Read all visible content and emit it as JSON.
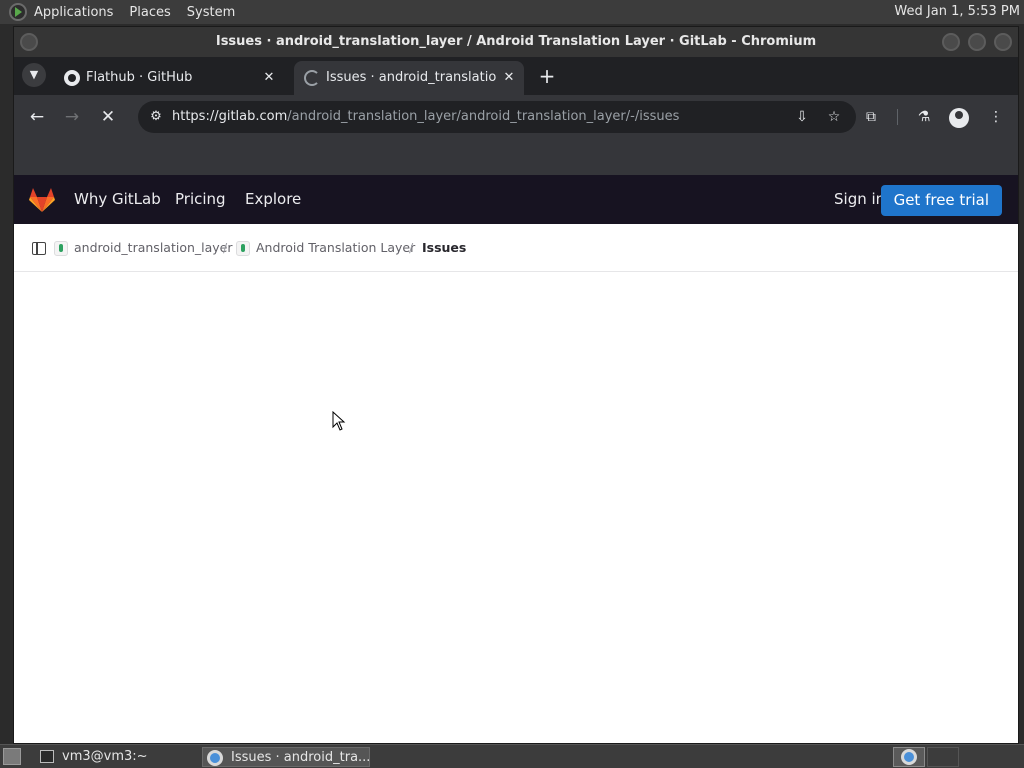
{
  "system_panel": {
    "menus": [
      "Applications",
      "Places",
      "System"
    ],
    "clock": "Wed Jan 1, 5:53 PM"
  },
  "window": {
    "title": "Issues · android_translation_layer / Android Translation Layer · GitLab - Chromium"
  },
  "tabs": [
    {
      "title": "Flathub · GitHub",
      "icon": "github-icon",
      "active": false
    },
    {
      "title": "Issues · android_translation_",
      "icon": "loading-icon",
      "active": true
    }
  ],
  "toolbar": {
    "url_domain": "https://gitlab.com",
    "url_path": "/android_translation_layer/android_translation_layer/-/issues"
  },
  "gitlab": {
    "nav": {
      "items": [
        "Why GitLab",
        "Pricing",
        "Explore"
      ],
      "sign_in": "Sign in",
      "trial": "Get free trial"
    },
    "breadcrumbs": {
      "group": "android_translation_layer",
      "project": "Android Translation Layer",
      "current": "Issues",
      "separator": "/"
    }
  },
  "taskbar": {
    "tasks": [
      {
        "label": "vm3@vm3:~",
        "icon": "terminal-icon"
      },
      {
        "label": "Issues · android_tra...",
        "icon": "chromium-icon"
      }
    ]
  },
  "colors": {
    "gitlab_nav_bg": "#171321",
    "trial_button": "#1f75cb",
    "chrome_dark": "#202124"
  }
}
